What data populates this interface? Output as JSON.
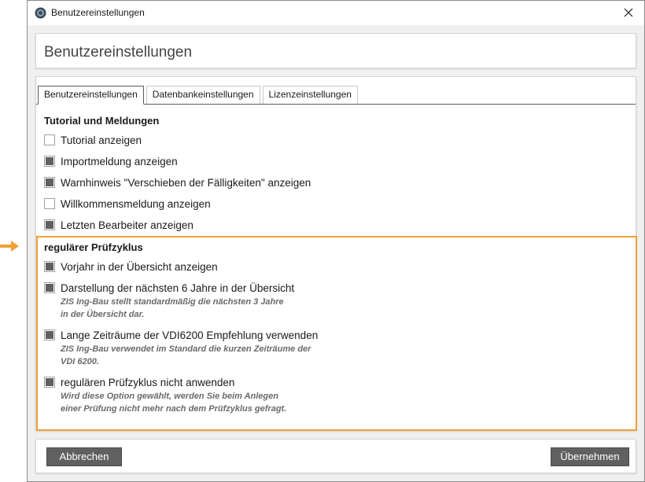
{
  "window": {
    "title": "Benutzereinstellungen"
  },
  "header": {
    "title": "Benutzereinstellungen"
  },
  "tabs": [
    {
      "label": "Benutzereinstellungen",
      "active": true
    },
    {
      "label": "Datenbankeinstellungen",
      "active": false
    },
    {
      "label": "Lizenzeinstellungen",
      "active": false
    }
  ],
  "tutorial_section": {
    "title": "Tutorial und Meldungen",
    "options": [
      {
        "label": "Tutorial anzeigen",
        "checked": false
      },
      {
        "label": "Importmeldung anzeigen",
        "checked": true
      },
      {
        "label": "Warnhinweis \"Verschieben der Fälligkeiten\" anzeigen",
        "checked": true
      },
      {
        "label": "Willkommensmeldung anzeigen",
        "checked": false
      },
      {
        "label": "Letzten Bearbeiter anzeigen",
        "checked": true
      }
    ]
  },
  "cycle_section": {
    "title": "regulärer Prüfzyklus",
    "options": [
      {
        "label": "Vorjahr in der Übersicht anzeigen",
        "checked": true,
        "desc1": "",
        "desc2": ""
      },
      {
        "label": "Darstellung der nächsten 6 Jahre in der Übersicht",
        "checked": true,
        "desc1": "ZIS Ing-Bau stellt standardmäßig die nächsten 3 Jahre",
        "desc2": "in der Übersicht dar."
      },
      {
        "label": "Lange Zeiträume der VDI6200 Empfehlung verwenden",
        "checked": true,
        "desc1": "ZIS Ing-Bau verwendet im Standard die kurzen Zeiträume der",
        "desc2": "VDI 6200."
      },
      {
        "label": "regulären Prüfzyklus nicht anwenden",
        "checked": true,
        "desc1": "Wird diese Option gewählt, werden Sie beim Anlegen",
        "desc2": "einer Prüfung nicht mehr nach dem Prüfzyklus gefragt."
      }
    ]
  },
  "footer": {
    "cancel_label": "Abbrechen",
    "apply_label": "Übernehmen"
  },
  "colors": {
    "highlight": "#f0a035",
    "button": "#606060"
  }
}
